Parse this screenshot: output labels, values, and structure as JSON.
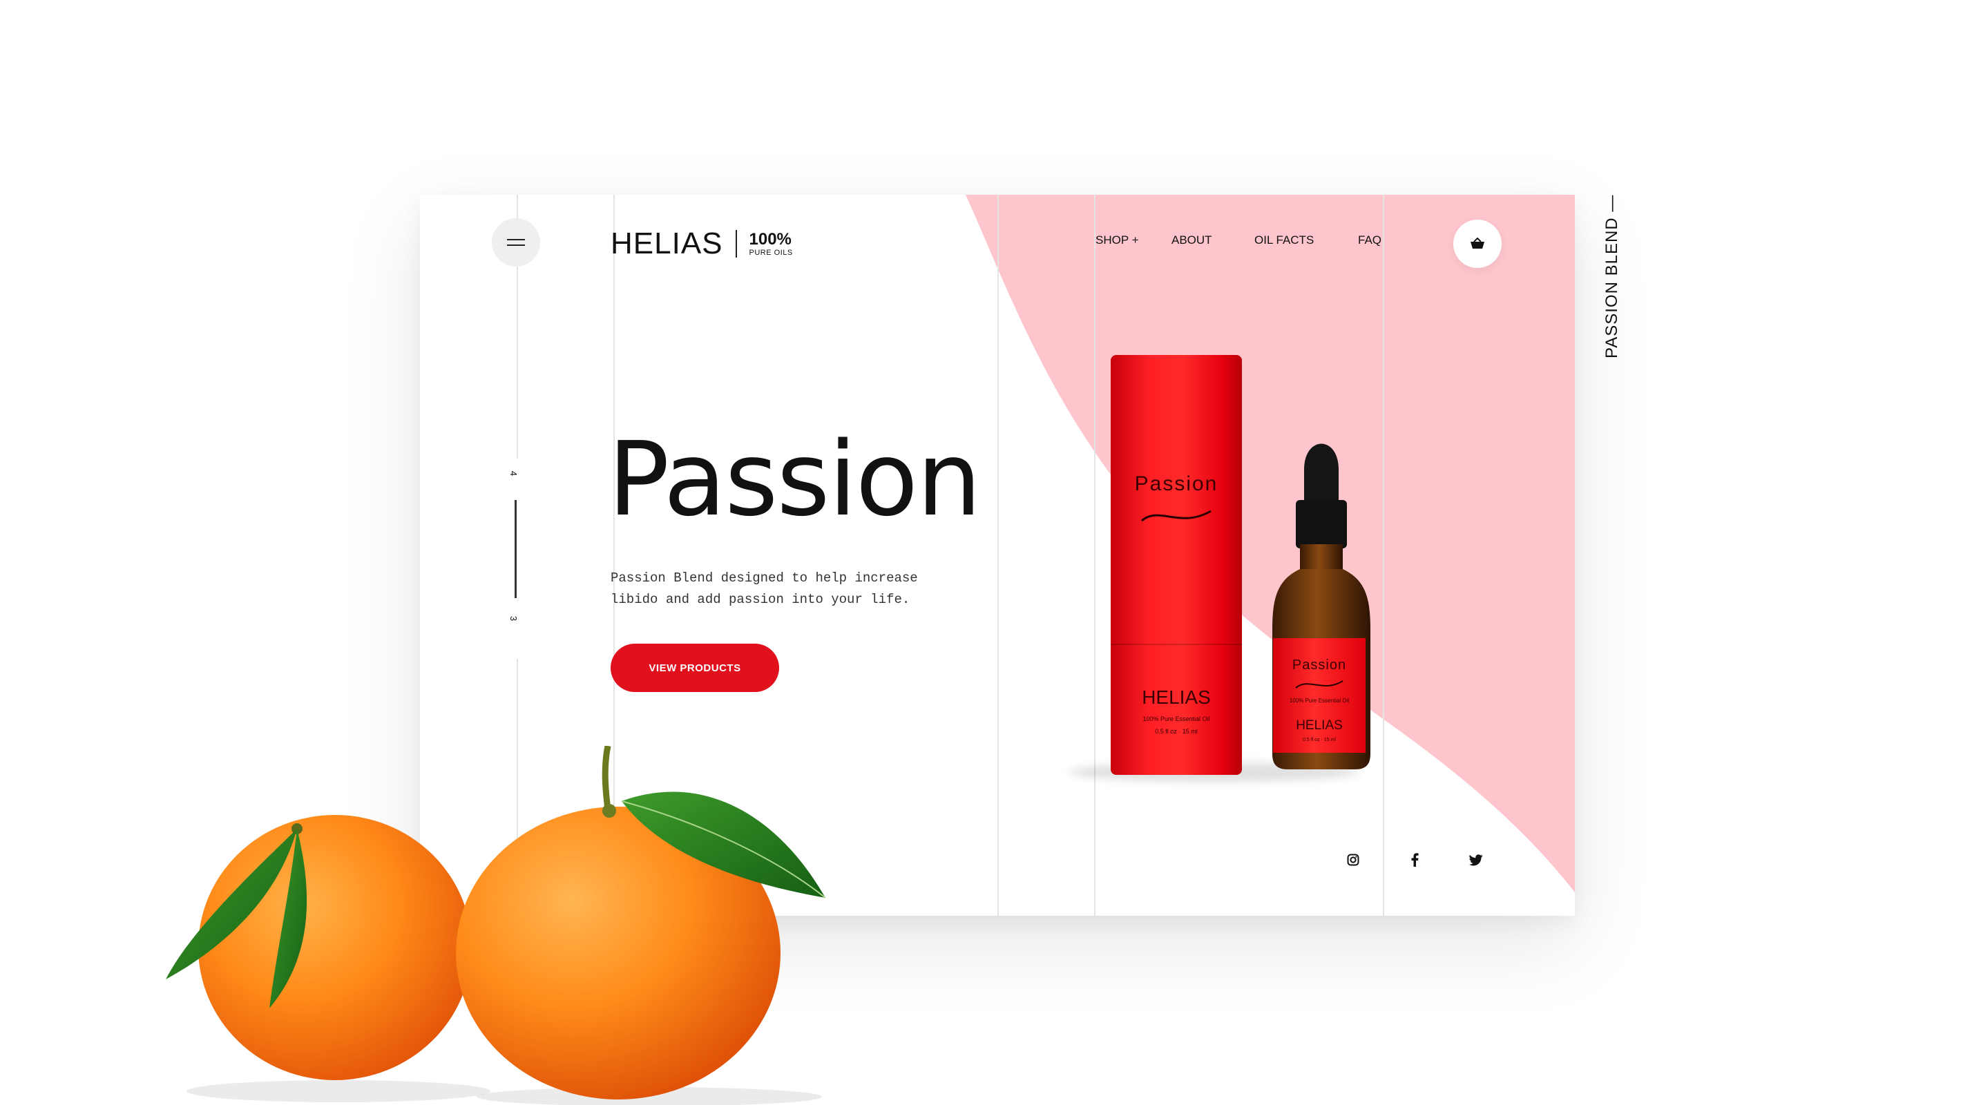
{
  "brand": {
    "name": "HELIAS",
    "percent": "100%",
    "tagline": "PURE OILS"
  },
  "nav": {
    "items": [
      "SHOP +",
      "ABOUT",
      "OIL FACTS",
      "FAQ"
    ]
  },
  "pager": {
    "current": "4",
    "next": "3"
  },
  "hero": {
    "title": "Passion",
    "description": "Passion Blend designed to help increase libido and add passion into your life.",
    "cta": "VIEW PRODUCTS"
  },
  "product": {
    "tube_name": "Passion",
    "tube_brand": "HELIAS",
    "tube_sub": "100% Pure Essential Oil",
    "tube_volume": "0.5 fl oz · 15 ml",
    "bottle_name": "Passion",
    "bottle_sub": "100% Pure Essential Oil",
    "bottle_brand": "HELIAS",
    "bottle_volume": "0.5 fl oz · 15 ml"
  },
  "socials": [
    "instagram-icon",
    "facebook-icon",
    "twitter-icon"
  ],
  "side_label": "PASSION BLEND —",
  "colors": {
    "accent": "#e0101d",
    "pink": "#fec5cc",
    "product_red": "#ff2a2a"
  }
}
